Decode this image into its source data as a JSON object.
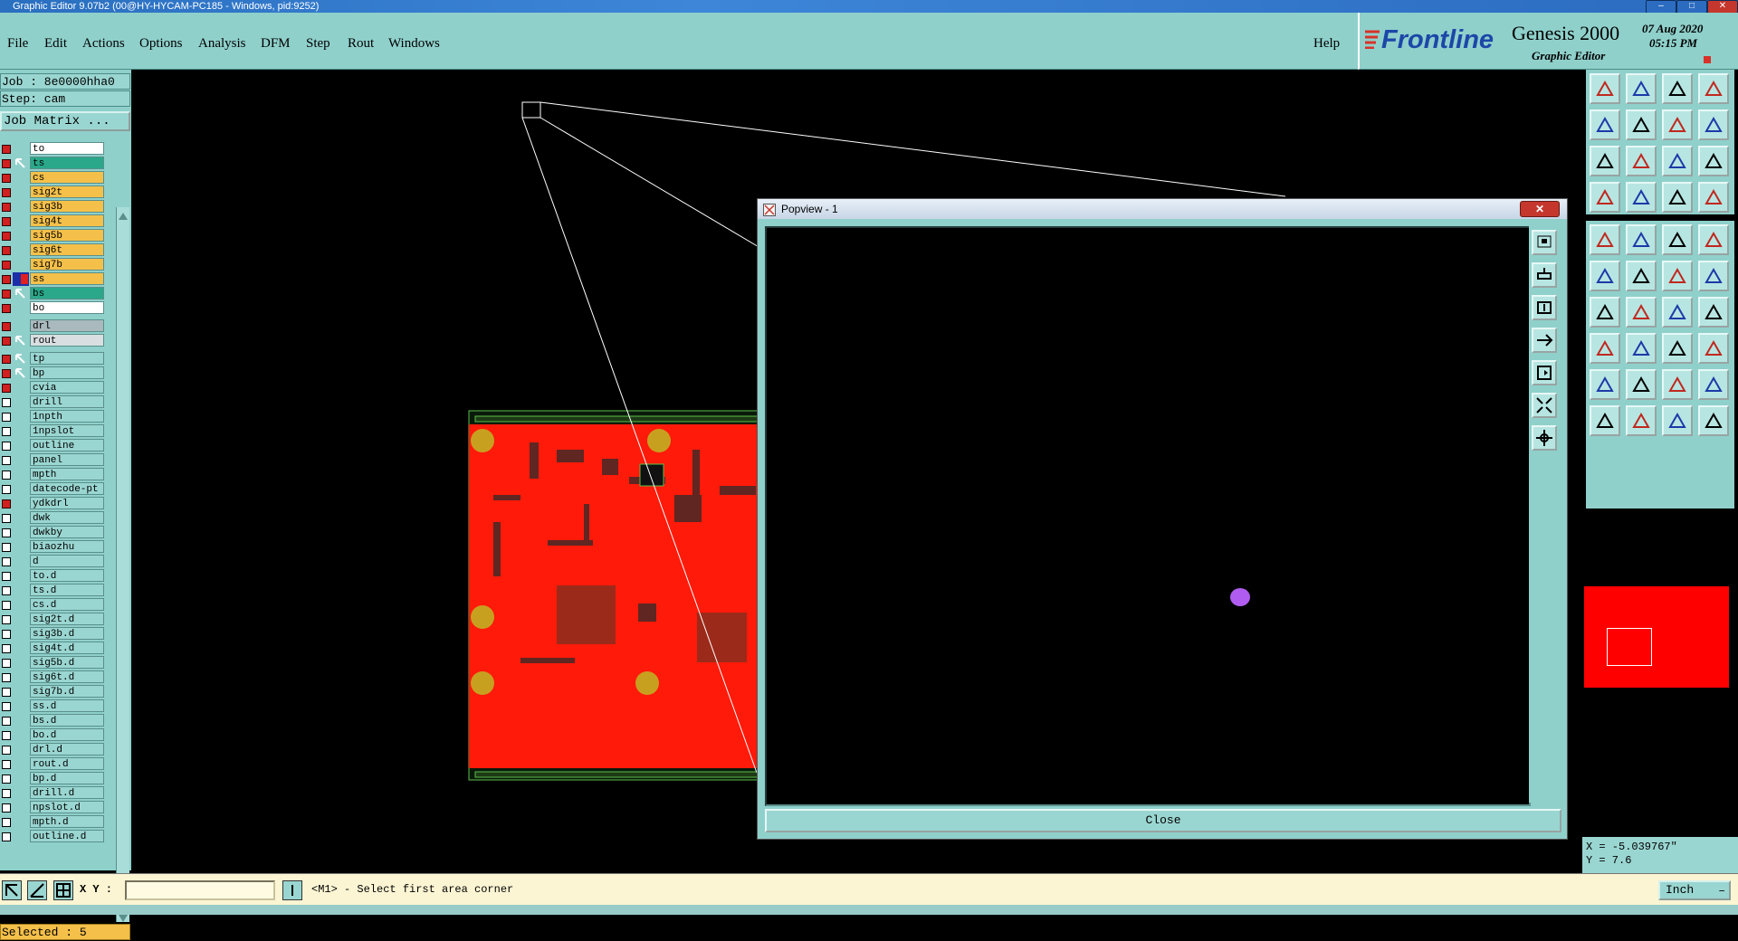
{
  "window": {
    "title": "Graphic Editor 9.07b2 (00@HY-HYCAM-PC185 - Windows, pid:9252)"
  },
  "menu": {
    "items": [
      "File",
      "Edit",
      "Actions",
      "Options",
      "Analysis",
      "DFM",
      "Step",
      "Rout",
      "Windows"
    ],
    "help": "Help"
  },
  "brand": {
    "logo": "Frontline",
    "product": "Genesis 2000",
    "subtitle": "Graphic Editor",
    "date": "07 Aug 2020",
    "time": "05:15 PM"
  },
  "job": {
    "job_line": "Job : 8e0000hha0",
    "step_line": "Step: cam",
    "matrix_button": "Job Matrix ..."
  },
  "layers": [
    {
      "name": "to",
      "color": "#ffffff",
      "checked": true,
      "state": ""
    },
    {
      "name": "ts",
      "color": "#2aa889",
      "checked": true,
      "state": "arrow"
    },
    {
      "name": "cs",
      "color": "#f4c04a",
      "checked": true,
      "state": ""
    },
    {
      "name": "sig2t",
      "color": "#f4c04a",
      "checked": true,
      "state": ""
    },
    {
      "name": "sig3b",
      "color": "#f4c04a",
      "checked": true,
      "state": ""
    },
    {
      "name": "sig4t",
      "color": "#f4c04a",
      "checked": true,
      "state": ""
    },
    {
      "name": "sig5b",
      "color": "#f4c04a",
      "checked": true,
      "state": ""
    },
    {
      "name": "sig6t",
      "color": "#f4c04a",
      "checked": true,
      "state": ""
    },
    {
      "name": "sig7b",
      "color": "#f4c04a",
      "checked": true,
      "state": ""
    },
    {
      "name": "ss",
      "color": "#f4c04a",
      "checked": true,
      "state": "work"
    },
    {
      "name": "bs",
      "color": "#2aa889",
      "checked": true,
      "state": "arrow"
    },
    {
      "name": "bo",
      "color": "#ffffff",
      "checked": true,
      "state": ""
    },
    {
      "name": "drl",
      "color": "#a9b9bd",
      "checked": true,
      "state": ""
    },
    {
      "name": "rout",
      "color": "#d9dfe1",
      "checked": true,
      "state": "arrow"
    },
    {
      "name": "tp",
      "color": "#9ad6d1",
      "checked": true,
      "state": "arrow"
    },
    {
      "name": "bp",
      "color": "#9ad6d1",
      "checked": true,
      "state": "arrow"
    },
    {
      "name": "cvia",
      "color": "#9ad6d1",
      "checked": true,
      "state": ""
    },
    {
      "name": "drill",
      "color": "#9ad6d1",
      "checked": false,
      "state": ""
    },
    {
      "name": "1npth",
      "color": "#9ad6d1",
      "checked": false,
      "state": ""
    },
    {
      "name": "1npslot",
      "color": "#9ad6d1",
      "checked": false,
      "state": ""
    },
    {
      "name": "outline",
      "color": "#9ad6d1",
      "checked": false,
      "state": ""
    },
    {
      "name": "panel",
      "color": "#9ad6d1",
      "checked": false,
      "state": ""
    },
    {
      "name": "mpth",
      "color": "#9ad6d1",
      "checked": false,
      "state": ""
    },
    {
      "name": "datecode-pt",
      "color": "#9ad6d1",
      "checked": false,
      "state": ""
    },
    {
      "name": "ydkdrl",
      "color": "#9ad6d1",
      "checked": true,
      "state": ""
    },
    {
      "name": "dwk",
      "color": "#9ad6d1",
      "checked": false,
      "state": ""
    },
    {
      "name": "dwkby",
      "color": "#9ad6d1",
      "checked": false,
      "state": ""
    },
    {
      "name": "biaozhu",
      "color": "#9ad6d1",
      "checked": false,
      "state": ""
    },
    {
      "name": "d",
      "color": "#9ad6d1",
      "checked": false,
      "state": ""
    },
    {
      "name": "to.d",
      "color": "#9ad6d1",
      "checked": false,
      "state": ""
    },
    {
      "name": "ts.d",
      "color": "#9ad6d1",
      "checked": false,
      "state": ""
    },
    {
      "name": "cs.d",
      "color": "#9ad6d1",
      "checked": false,
      "state": ""
    },
    {
      "name": "sig2t.d",
      "color": "#9ad6d1",
      "checked": false,
      "state": ""
    },
    {
      "name": "sig3b.d",
      "color": "#9ad6d1",
      "checked": false,
      "state": ""
    },
    {
      "name": "sig4t.d",
      "color": "#9ad6d1",
      "checked": false,
      "state": ""
    },
    {
      "name": "sig5b.d",
      "color": "#9ad6d1",
      "checked": false,
      "state": ""
    },
    {
      "name": "sig6t.d",
      "color": "#9ad6d1",
      "checked": false,
      "state": ""
    },
    {
      "name": "sig7b.d",
      "color": "#9ad6d1",
      "checked": false,
      "state": ""
    },
    {
      "name": "ss.d",
      "color": "#9ad6d1",
      "checked": false,
      "state": ""
    },
    {
      "name": "bs.d",
      "color": "#9ad6d1",
      "checked": false,
      "state": ""
    },
    {
      "name": "bo.d",
      "color": "#9ad6d1",
      "checked": false,
      "state": ""
    },
    {
      "name": "drl.d",
      "color": "#9ad6d1",
      "checked": false,
      "state": ""
    },
    {
      "name": "rout.d",
      "color": "#9ad6d1",
      "checked": false,
      "state": ""
    },
    {
      "name": "bp.d",
      "color": "#9ad6d1",
      "checked": false,
      "state": ""
    },
    {
      "name": "drill.d",
      "color": "#9ad6d1",
      "checked": false,
      "state": ""
    },
    {
      "name": "npslot.d",
      "color": "#9ad6d1",
      "checked": false,
      "state": ""
    },
    {
      "name": "mpth.d",
      "color": "#9ad6d1",
      "checked": false,
      "state": ""
    },
    {
      "name": "outline.d",
      "color": "#9ad6d1",
      "checked": false,
      "state": ""
    }
  ],
  "selected": "Selected : 5",
  "popview": {
    "title": "Popview - 1",
    "close_label": "Close"
  },
  "status": {
    "xy_label": "X Y :",
    "xy_value": "",
    "prompt": "<M1> - Select first area corner",
    "unit": "Inch",
    "x_coord": "X = -5.039767\"",
    "y_coord": "Y = 7.6"
  },
  "colors": {
    "panel": "#8fd0cb",
    "board": "#ff0000",
    "pad": "#c8a020",
    "cursor_dot": "#b05cf0"
  }
}
